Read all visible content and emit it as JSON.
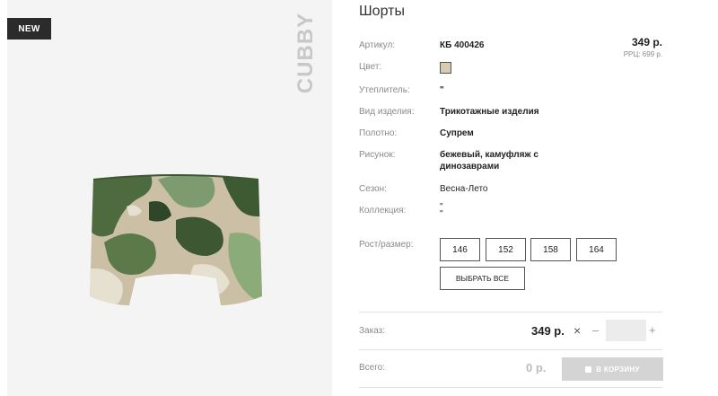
{
  "product_image": {
    "badge": "NEW",
    "brand": "CUBBY"
  },
  "product": {
    "title": "Шорты",
    "price": "349 р.",
    "rrc_price": "РРЦ: 699 р."
  },
  "details": [
    {
      "label": "Артикул:",
      "value": "КБ 400426"
    },
    {
      "label": "Цвет:",
      "value": ""
    },
    {
      "label": "Утеплитель:",
      "value": "\""
    },
    {
      "label": "Вид изделия:",
      "value": "Трикотажные изделия"
    },
    {
      "label": "Полотно:",
      "value": "Супрем"
    },
    {
      "label": "Рисунок:",
      "value": "бежевый, камуфляж с динозаврами"
    },
    {
      "label": "Сезон:",
      "value": "Весна-Лето"
    },
    {
      "label": "Коллекция:",
      "value": "\"\n\""
    }
  ],
  "color_swatch": "#d9cbb0",
  "sizes": {
    "label": "Рост/размер:",
    "options": [
      "146",
      "152",
      "158",
      "164"
    ],
    "select_all_label": "ВЫБРАТЬ ВСЕ"
  },
  "order": {
    "label": "Заказ:",
    "price": "349 р.",
    "times": "×",
    "minus": "–",
    "plus": "+",
    "quantity": ""
  },
  "total": {
    "label": "Всего:",
    "value": "0 р.",
    "cart_button_label": "В КОРЗИНУ"
  }
}
